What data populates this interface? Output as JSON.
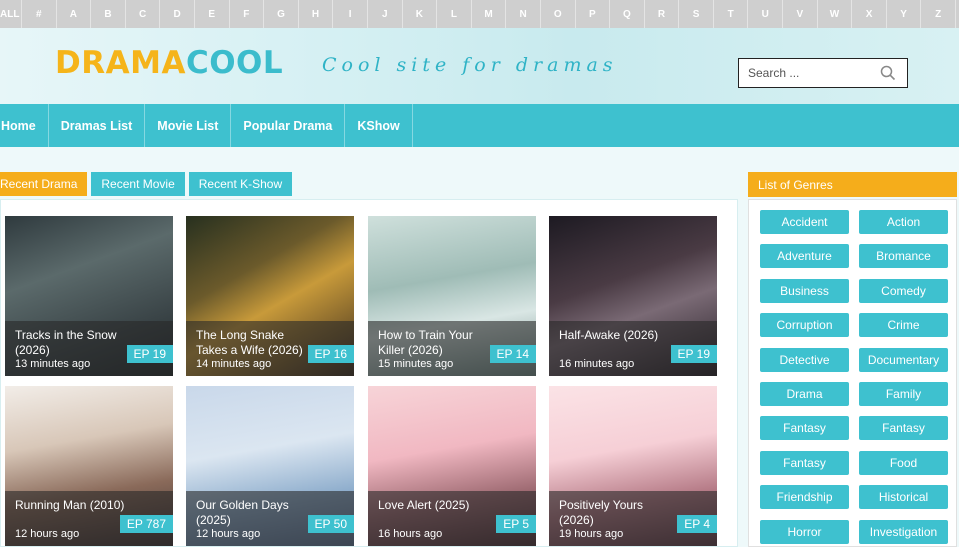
{
  "alphabet": [
    "ALL",
    "#",
    "A",
    "B",
    "C",
    "D",
    "E",
    "F",
    "G",
    "H",
    "I",
    "J",
    "K",
    "L",
    "M",
    "N",
    "O",
    "P",
    "Q",
    "R",
    "S",
    "T",
    "U",
    "V",
    "W",
    "X",
    "Y",
    "Z"
  ],
  "header": {
    "logo_part1": "DRAMA",
    "logo_part2": "COOL",
    "tagline": "Cool site for dramas",
    "search_placeholder": "Search ..."
  },
  "nav": [
    "Home",
    "Dramas List",
    "Movie List",
    "Popular Drama",
    "KShow"
  ],
  "tabs": [
    "Recent Drama",
    "Recent Movie",
    "Recent K-Show"
  ],
  "cards": [
    {
      "title": "Tracks in the Snow (2026)",
      "time": "13 minutes ago",
      "ep": "EP 19"
    },
    {
      "title": "The Long Snake Takes a Wife (2026)",
      "time": "14 minutes ago",
      "ep": "EP 16"
    },
    {
      "title": "How to Train Your Killer (2026)",
      "time": "15 minutes ago",
      "ep": "EP 14"
    },
    {
      "title": "Half-Awake (2026)",
      "time": "16 minutes ago",
      "ep": "EP 19"
    },
    {
      "title": "Running Man (2010)",
      "time": "12 hours ago",
      "ep": "EP 787"
    },
    {
      "title": "Our Golden Days (2025)",
      "time": "12 hours ago",
      "ep": "EP 50"
    },
    {
      "title": "Love Alert (2025)",
      "time": "16 hours ago",
      "ep": "EP 5"
    },
    {
      "title": "Positively Yours (2026)",
      "time": "19 hours ago",
      "ep": "EP 4"
    }
  ],
  "genres_title": "List of Genres",
  "genres": [
    "Accident",
    "Action",
    "Adventure",
    "Bromance",
    "Business",
    "Comedy",
    "Corruption",
    "Crime",
    "Detective",
    "Documentary",
    "Drama",
    "Family",
    "Fantasy",
    "Fantasy",
    "Fantasy",
    "Food",
    "Friendship",
    "Historical",
    "Horror",
    "Investigation"
  ],
  "colors": {
    "accent": "#3ec1cf",
    "highlight": "#f5ad1b"
  }
}
